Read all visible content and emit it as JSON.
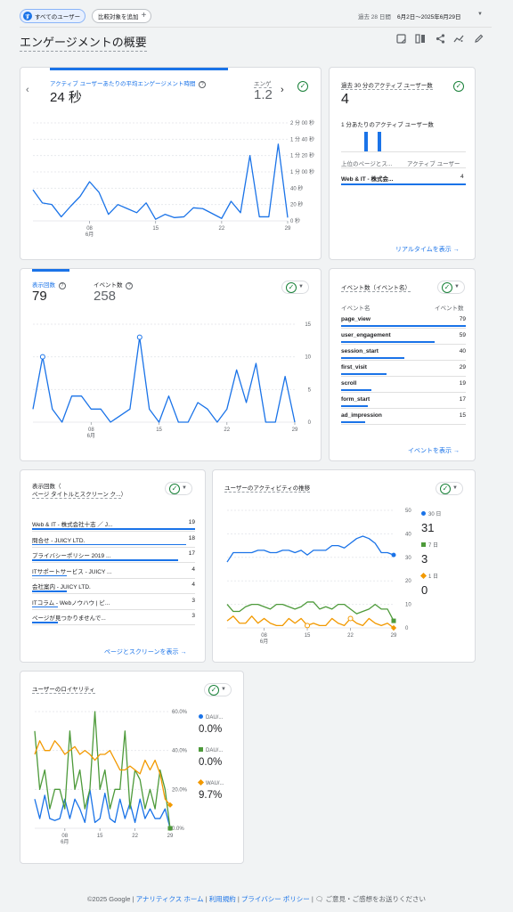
{
  "header": {
    "segment_chip": "すべてのユーザー",
    "segment_avatar": "す",
    "compare_chip": "比較対象を追加",
    "date_prefix": "過去 28 日間",
    "date_range": "6月2日～2025年6月29日",
    "page_title": "エンゲージメントの概要"
  },
  "card_engagement": {
    "tab1_label": "アクティブ ユーザーあたりの平均エンゲージメント時間",
    "tab1_value": "24 秒",
    "tab2_label": "エンゲ",
    "tab2_value": "1.2",
    "x_ticks": [
      "08",
      "15",
      "22",
      "29"
    ],
    "x_month": "6月",
    "y_ticks": [
      "2 分 00 秒",
      "1 分 40 秒",
      "1 分 20 秒",
      "1 分 00 秒",
      "40 秒",
      "20 秒",
      "0 秒"
    ]
  },
  "card_realtime": {
    "title": "過去 30 分のアクティブ ユーザー数",
    "value": "4",
    "per_minute": "1 分あたりのアクティブ ユーザー数",
    "col1": "上位のページとス...",
    "col2": "アクティブ ユーザー",
    "row_label": "Web & IT - 株式会...",
    "row_value": "4",
    "link": "リアルタイムを表示"
  },
  "card_views": {
    "tab1_label": "表示回数",
    "tab1_value": "79",
    "tab2_label": "イベント数",
    "tab2_value": "258",
    "x_ticks": [
      "08",
      "15",
      "22",
      "29"
    ],
    "x_month": "6月",
    "y_ticks": [
      "15",
      "10",
      "5",
      "0"
    ]
  },
  "card_events": {
    "title": "イベント数（イベント名）",
    "col1": "イベント名",
    "col2": "イベント数",
    "rows": [
      {
        "name": "page_view",
        "value": "79"
      },
      {
        "name": "user_engagement",
        "value": "59"
      },
      {
        "name": "session_start",
        "value": "40"
      },
      {
        "name": "first_visit",
        "value": "29"
      },
      {
        "name": "scroll",
        "value": "19"
      },
      {
        "name": "form_start",
        "value": "17"
      },
      {
        "name": "ad_impression",
        "value": "15"
      }
    ],
    "link": "イベントを表示"
  },
  "card_pages": {
    "title1": "表示回数（",
    "title2": "ページ タイトルとスクリーン ク...",
    "title_close": "）",
    "rows": [
      {
        "name": "Web & IT - 株式会社十志 ／ J...",
        "value": "19"
      },
      {
        "name": "問合せ - JUICY LTD.",
        "value": "18"
      },
      {
        "name": "プライバシーポリシー 2019 ...",
        "value": "17"
      },
      {
        "name": "ITサポートサービス - JUICY ...",
        "value": "4"
      },
      {
        "name": "会社案内 - JUICY LTD.",
        "value": "4"
      },
      {
        "name": "ITコラム - Webノウハウ | ビ...",
        "value": "3"
      },
      {
        "name": "ページが見つかりませんで...",
        "value": "3"
      }
    ],
    "link": "ページとスクリーンを表示"
  },
  "card_activity": {
    "title": "ユーザーのアクティビティの推移",
    "y_ticks": [
      "50",
      "40",
      "30",
      "20",
      "10",
      "0"
    ],
    "x_ticks": [
      "08",
      "15",
      "22",
      "29"
    ],
    "x_month": "6月",
    "legend": [
      {
        "label": "30 日",
        "value": "31",
        "color": "#1a73e8"
      },
      {
        "label": "7 日",
        "value": "3",
        "color": "#4d9a3a"
      },
      {
        "label": "1 日",
        "value": "0",
        "color": "#f29900"
      }
    ]
  },
  "card_loyalty": {
    "title": "ユーザーのロイヤリティ",
    "y_ticks": [
      "60.0%",
      "40.0%",
      "20.0%",
      "0.0%"
    ],
    "x_ticks": [
      "08",
      "15",
      "22",
      "29"
    ],
    "x_month": "6月",
    "legend": [
      {
        "label": "DAU/...",
        "value": "0.0%",
        "color": "#1a73e8"
      },
      {
        "label": "DAU/...",
        "value": "0.0%",
        "color": "#4d9a3a"
      },
      {
        "label": "WAU/...",
        "value": "9.7%",
        "color": "#f29900"
      }
    ]
  },
  "footer": {
    "copyright": "©2025 Google",
    "link1": "アナリティクス ホーム",
    "link2": "利用規約",
    "link3": "プライバシー ポリシー",
    "feedback": "ご意見・ご感想をお送りください"
  },
  "chart_data": [
    {
      "type": "line",
      "title": "アクティブ ユーザーあたりの平均エンゲージメント時間",
      "ylabel": "",
      "ylim": [
        0,
        120
      ],
      "x": [
        1,
        2,
        3,
        4,
        5,
        6,
        7,
        8,
        9,
        10,
        11,
        12,
        13,
        14,
        15,
        16,
        17,
        18,
        19,
        20,
        21,
        22,
        23,
        24,
        25,
        26,
        27,
        28
      ],
      "series": [
        {
          "name": "",
          "values": [
            38,
            22,
            20,
            5,
            18,
            30,
            48,
            35,
            8,
            20,
            15,
            10,
            22,
            2,
            8,
            4,
            5,
            16,
            15,
            9,
            3,
            24,
            10,
            80,
            5,
            5,
            94,
            4
          ]
        }
      ]
    },
    {
      "type": "line",
      "title": "表示回数",
      "ylim": [
        0,
        15
      ],
      "x": [
        1,
        2,
        3,
        4,
        5,
        6,
        7,
        8,
        9,
        10,
        11,
        12,
        13,
        14,
        15,
        16,
        17,
        18,
        19,
        20,
        21,
        22,
        23,
        24,
        25,
        26,
        27,
        28
      ],
      "series": [
        {
          "name": "",
          "values": [
            2,
            10,
            2,
            0,
            4,
            4,
            2,
            2,
            0,
            1,
            2,
            13,
            2,
            0,
            4,
            0,
            0,
            3,
            2,
            0,
            2,
            8,
            3,
            9,
            0,
            0,
            7,
            0
          ]
        }
      ]
    },
    {
      "type": "line",
      "title": "ユーザーのアクティビティの推移",
      "ylim": [
        0,
        50
      ],
      "x": [
        1,
        2,
        3,
        4,
        5,
        6,
        7,
        8,
        9,
        10,
        11,
        12,
        13,
        14,
        15,
        16,
        17,
        18,
        19,
        20,
        21,
        22,
        23,
        24,
        25,
        26,
        27,
        28
      ],
      "series": [
        {
          "name": "30 日",
          "values": [
            28,
            32,
            32,
            32,
            32,
            33,
            33,
            32,
            32,
            33,
            33,
            32,
            33,
            31,
            33,
            33,
            33,
            35,
            35,
            34,
            36,
            38,
            39,
            38,
            36,
            32,
            32,
            31
          ]
        },
        {
          "name": "7 日",
          "values": [
            10,
            7,
            7,
            9,
            10,
            10,
            9,
            8,
            10,
            10,
            9,
            8,
            9,
            11,
            11,
            8,
            9,
            8,
            10,
            10,
            8,
            6,
            7,
            8,
            10,
            8,
            8,
            3
          ]
        },
        {
          "name": "1 日",
          "values": [
            3,
            5,
            2,
            2,
            5,
            2,
            4,
            2,
            1,
            1,
            4,
            2,
            4,
            1,
            2,
            1,
            1,
            4,
            2,
            1,
            4,
            2,
            1,
            4,
            2,
            1,
            2,
            0
          ]
        }
      ]
    },
    {
      "type": "line",
      "title": "ユーザーのロイヤリティ",
      "ylim": [
        0,
        60
      ],
      "x": [
        1,
        2,
        3,
        4,
        5,
        6,
        7,
        8,
        9,
        10,
        11,
        12,
        13,
        14,
        15,
        16,
        17,
        18,
        19,
        20,
        21,
        22,
        23,
        24,
        25,
        26,
        27,
        28
      ],
      "series": [
        {
          "name": "DAU/...",
          "values": [
            15,
            5,
            17,
            5,
            4,
            5,
            15,
            5,
            15,
            10,
            3,
            20,
            3,
            5,
            18,
            5,
            3,
            15,
            5,
            13,
            3,
            15,
            5,
            10,
            5,
            5,
            10,
            0
          ]
        },
        {
          "name": "DAU/...",
          "values": [
            50,
            20,
            30,
            10,
            20,
            20,
            10,
            50,
            20,
            30,
            10,
            20,
            60,
            20,
            30,
            10,
            20,
            20,
            50,
            10,
            30,
            25,
            10,
            20,
            10,
            30,
            20,
            0
          ]
        },
        {
          "name": "WAU/...",
          "values": [
            38,
            45,
            40,
            40,
            45,
            42,
            38,
            40,
            42,
            38,
            40,
            38,
            35,
            38,
            38,
            40,
            35,
            30,
            30,
            32,
            30,
            28,
            35,
            30,
            35,
            28,
            15,
            12
          ]
        }
      ]
    }
  ]
}
